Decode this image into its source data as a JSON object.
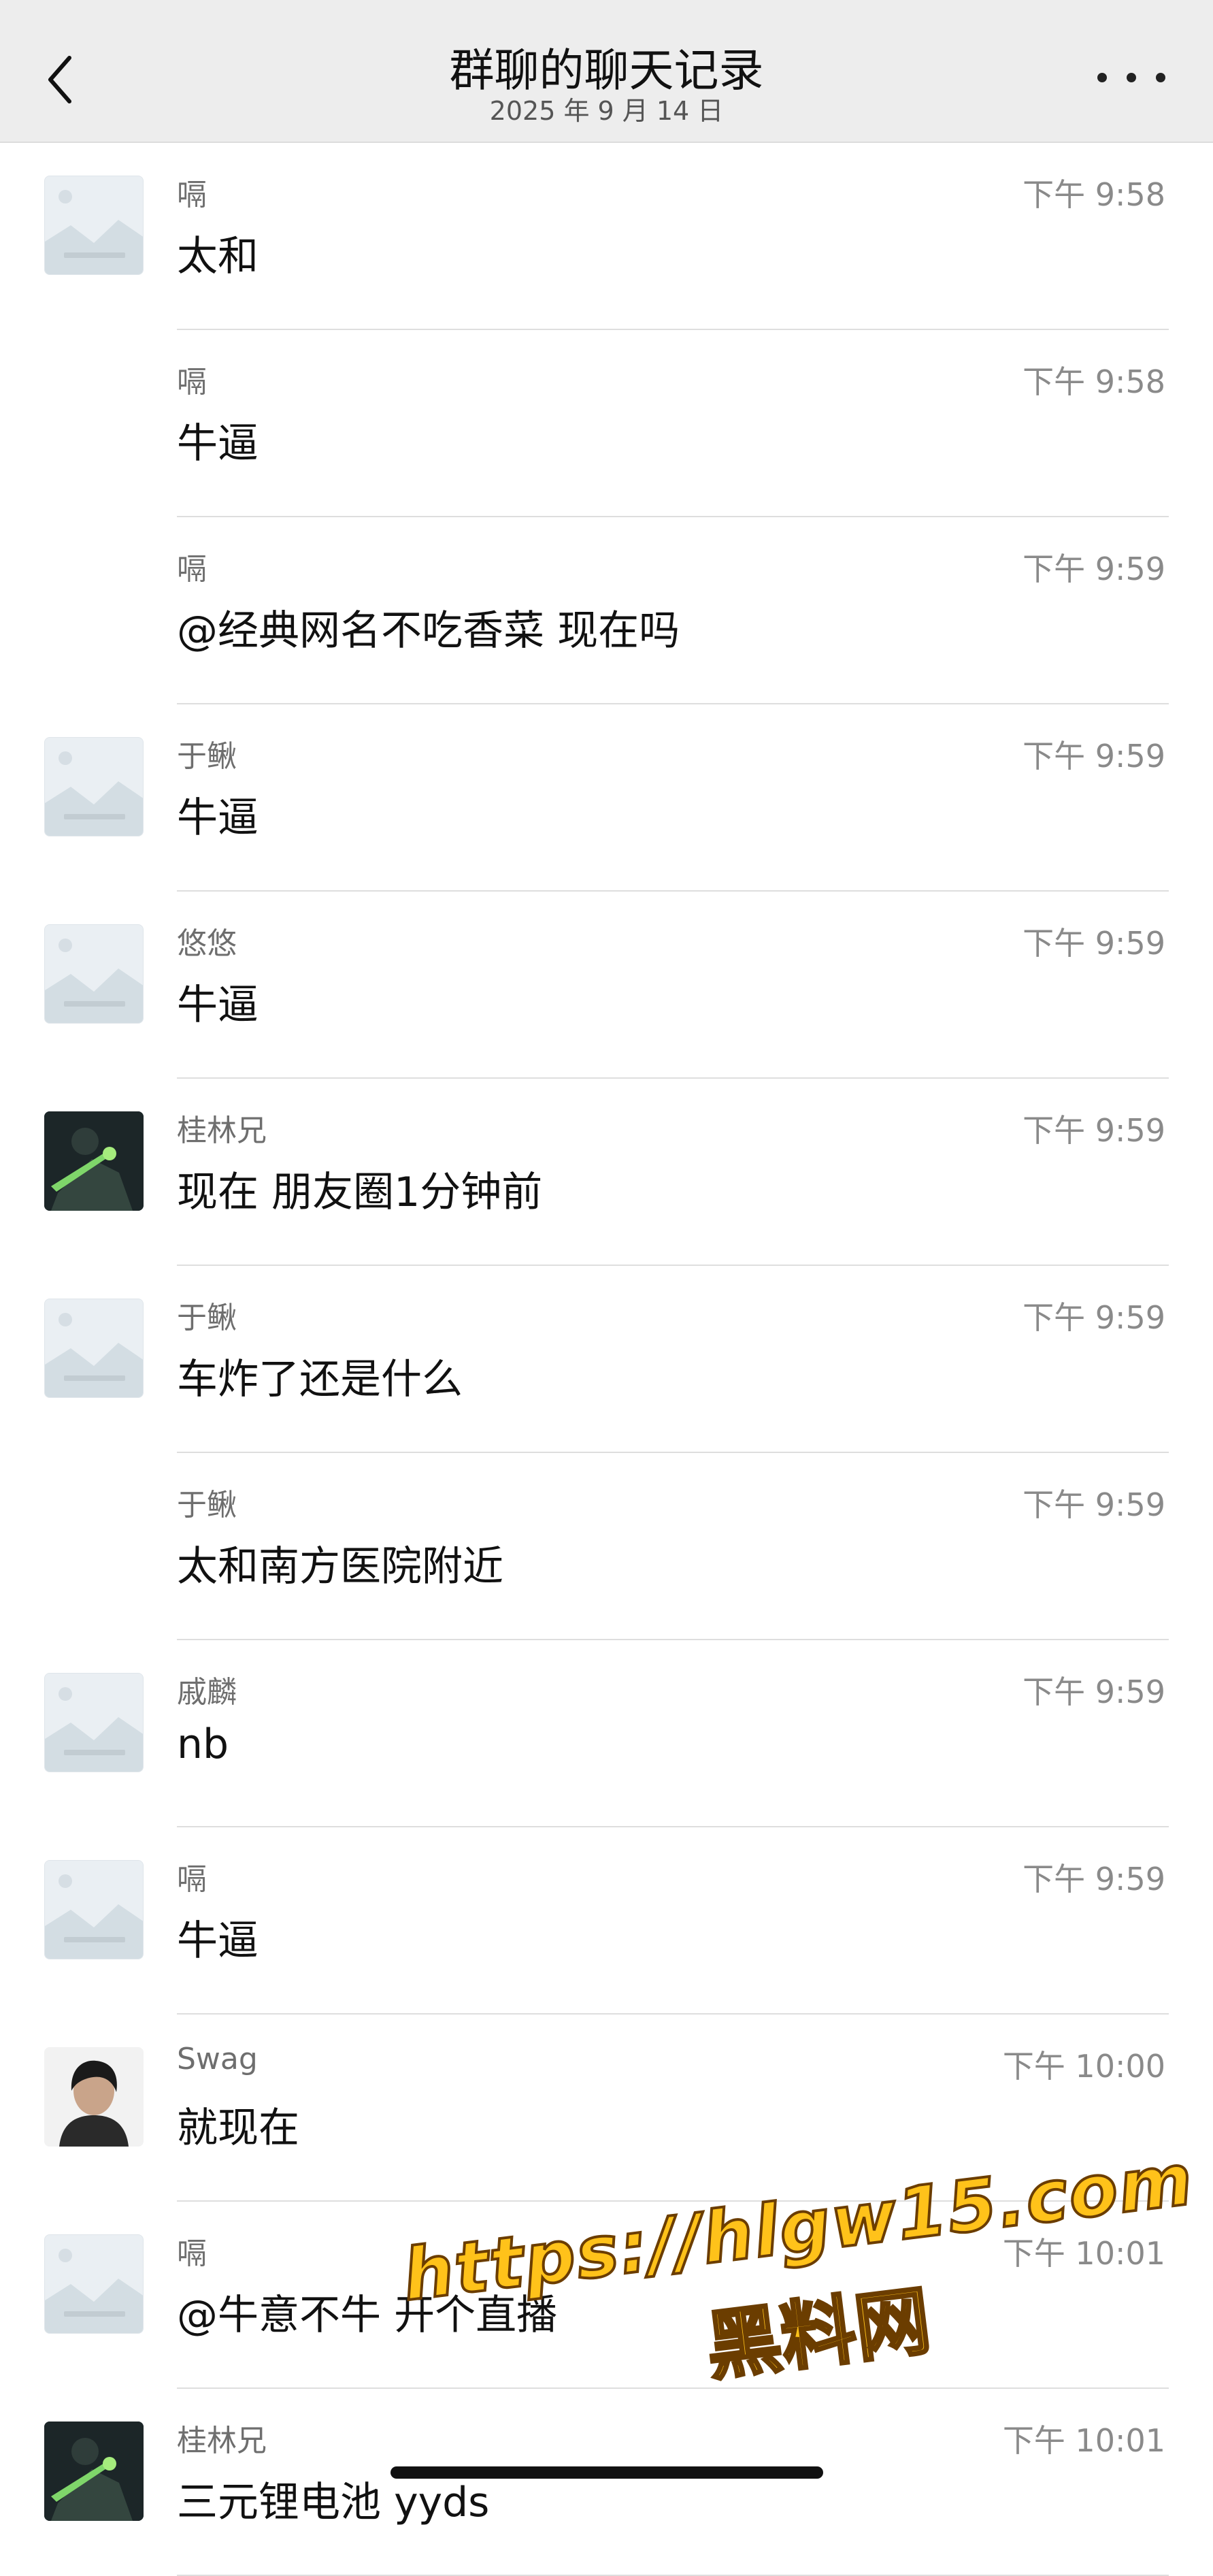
{
  "header": {
    "title": "群聊的聊天记录",
    "date": "2025 年 9 月 14 日",
    "back_icon": "chevron-left-icon",
    "more_icon": "more-horizontal-icon"
  },
  "messages": [
    {
      "sender": "嗝",
      "time": "下午 9:58",
      "text": "太和",
      "avatar": "placeholder"
    },
    {
      "sender": "嗝",
      "time": "下午 9:58",
      "text": "牛逼",
      "avatar": "none"
    },
    {
      "sender": "嗝",
      "time": "下午 9:59",
      "text": "@经典网名不吃香菜 现在吗",
      "avatar": "none"
    },
    {
      "sender": "于鳅",
      "time": "下午 9:59",
      "text": "牛逼",
      "avatar": "placeholder"
    },
    {
      "sender": "悠悠",
      "time": "下午 9:59",
      "text": "牛逼",
      "avatar": "placeholder"
    },
    {
      "sender": "桂林兄",
      "time": "下午 9:59",
      "text": "现在 朋友圈1分钟前",
      "avatar": "dark"
    },
    {
      "sender": "于鳅",
      "time": "下午 9:59",
      "text": "车炸了还是什么",
      "avatar": "placeholder"
    },
    {
      "sender": "于鳅",
      "time": "下午 9:59",
      "text": "太和南方医院附近",
      "avatar": "none"
    },
    {
      "sender": "戚麟",
      "time": "下午 9:59",
      "text": "nb",
      "avatar": "placeholder"
    },
    {
      "sender": "嗝",
      "time": "下午 9:59",
      "text": "牛逼",
      "avatar": "placeholder"
    },
    {
      "sender": "Swag",
      "time": "下午 10:00",
      "text": "就现在",
      "avatar": "person"
    },
    {
      "sender": "嗝",
      "time": "下午 10:01",
      "text": "@牛意不牛 开个直播",
      "avatar": "placeholder"
    },
    {
      "sender": "桂林兄",
      "time": "下午 10:01",
      "text": "三元锂电池 yyds",
      "avatar": "dark"
    }
  ],
  "watermark": {
    "url": "https://hlgw15.com",
    "name": "黑料网"
  },
  "colors": {
    "header_bg": "#ededed",
    "divider": "#dedede",
    "sender_text": "#6e6e6e",
    "time_text": "#8a8a8a",
    "watermark": "#ffc21a"
  }
}
